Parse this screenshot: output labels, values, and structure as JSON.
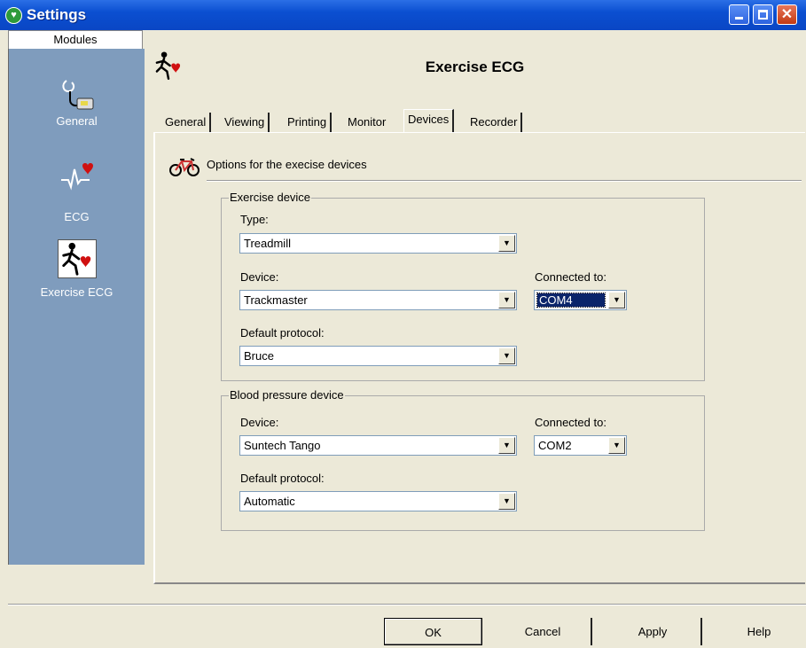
{
  "window": {
    "title": "Settings"
  },
  "sidebar": {
    "header": "Modules",
    "items": [
      {
        "label": "General",
        "icon": "stethoscope-device-icon"
      },
      {
        "label": "ECG",
        "icon": "ecg-heart-icon"
      },
      {
        "label": "Exercise ECG",
        "icon": "runner-heart-icon",
        "selected": true
      }
    ]
  },
  "header": {
    "title": "Exercise ECG"
  },
  "tabs": [
    "General",
    "Viewing",
    "Printing",
    "Monitor",
    "Devices",
    "Recorder"
  ],
  "active_tab": "Devices",
  "panel": {
    "caption": "Options for the execise devices",
    "exercise_device": {
      "title": "Exercise device",
      "type_label": "Type:",
      "type_value": "Treadmill",
      "device_label": "Device:",
      "device_value": "Trackmaster",
      "connected_label": "Connected to:",
      "connected_value": "COM4",
      "protocol_label": "Default protocol:",
      "protocol_value": "Bruce"
    },
    "bp_device": {
      "title": "Blood pressure device",
      "device_label": "Device:",
      "device_value": "Suntech Tango",
      "connected_label": "Connected to:",
      "connected_value": "COM2",
      "protocol_label": "Default protocol:",
      "protocol_value": "Automatic"
    }
  },
  "buttons": {
    "ok": "OK",
    "cancel": "Cancel",
    "apply": "Apply",
    "help": "Help"
  },
  "colors": {
    "titlebar": "#0b4fd1",
    "sidebar": "#7f9cbd",
    "dialog": "#ece9d8"
  }
}
